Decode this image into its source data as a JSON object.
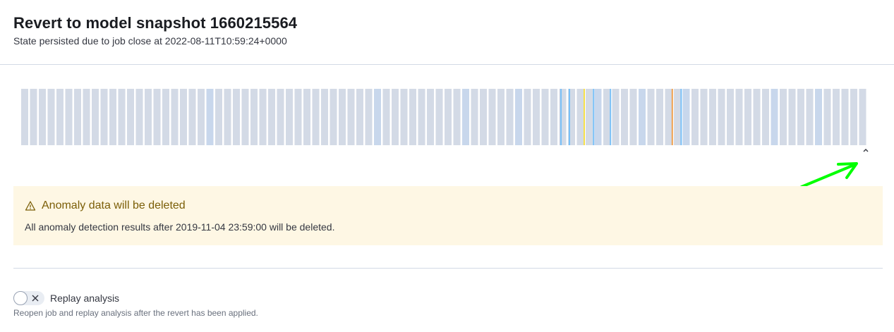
{
  "header": {
    "title": "Revert to model snapshot 1660215564",
    "subtitle": "State persisted due to job close at 2022-08-11T10:59:24+0000"
  },
  "chart_data": {
    "type": "bar",
    "bucket_count": 96,
    "base_color": "#d3dae6",
    "highlight_color": "#c8d7ec",
    "highlighted_buckets": [
      {
        "index": 21,
        "color": "#c8d7ec"
      },
      {
        "index": 40,
        "color": "#c8d7ec"
      },
      {
        "index": 50,
        "color": "#c8d7ec"
      },
      {
        "index": 56,
        "color": "#c8d7ec"
      },
      {
        "index": 65,
        "color": "#c8d7ec"
      },
      {
        "index": 70,
        "color": "#c8d7ec"
      },
      {
        "index": 75,
        "color": "#c8d7ec"
      },
      {
        "index": 85,
        "color": "#c8d7ec"
      },
      {
        "index": 90,
        "color": "#c8d7ec"
      }
    ],
    "anomaly_markers": [
      {
        "position": 0.6375,
        "color": "#79c0f7"
      },
      {
        "position": 0.6475,
        "color": "#79c0f7"
      },
      {
        "position": 0.665,
        "color": "#f5e04a"
      },
      {
        "position": 0.676,
        "color": "#79c0f7"
      },
      {
        "position": 0.696,
        "color": "#79c0f7"
      },
      {
        "position": 0.769,
        "color": "#f0a14f"
      },
      {
        "position": 0.7795,
        "color": "#79c0f7"
      }
    ]
  },
  "callout": {
    "title": "Anomaly data will be deleted",
    "body": "All anomaly detection results after 2019-11-04 23:59:00 will be deleted.",
    "icon": "warning-icon",
    "color": "#7b5e07",
    "background": "#fef7e4"
  },
  "replay": {
    "label": "Replay analysis",
    "checked": false,
    "help": "Reopen job and replay analysis after the revert has been applied."
  }
}
